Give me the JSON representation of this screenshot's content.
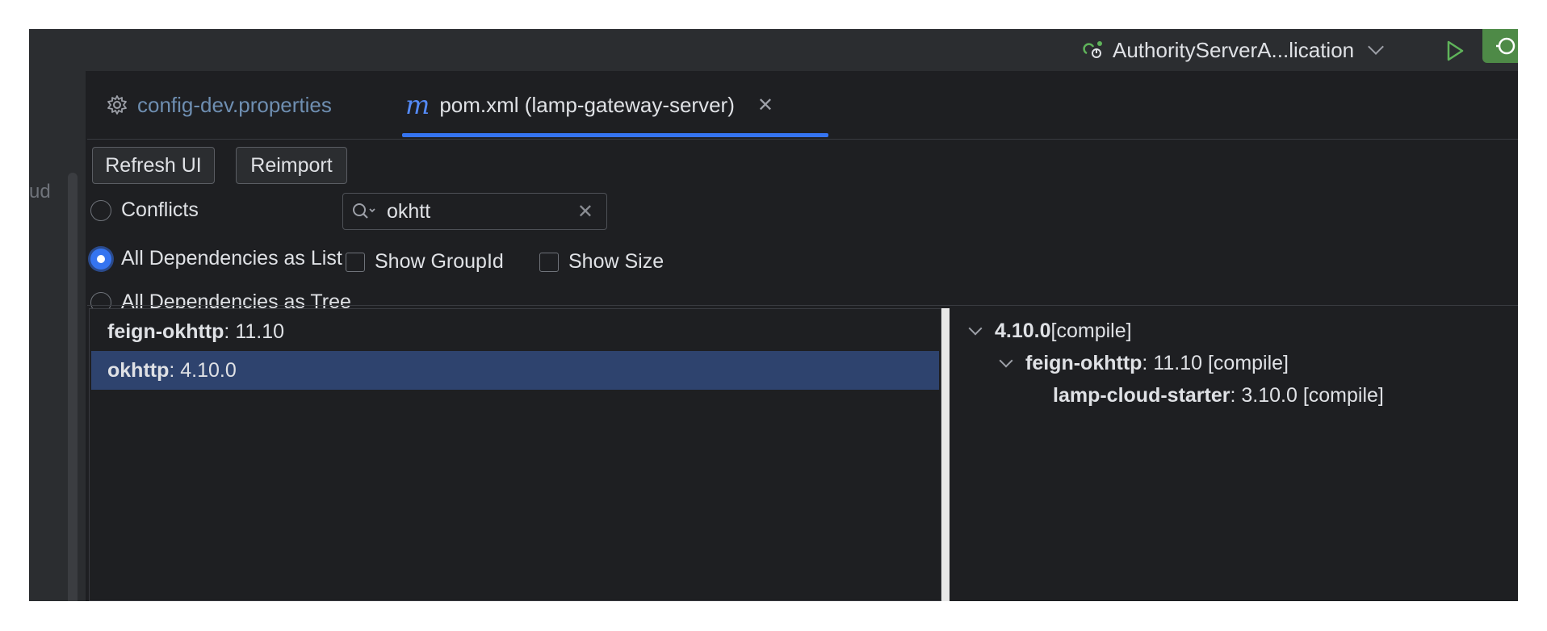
{
  "toolbar": {
    "run_config": "AuthorityServerA...lication"
  },
  "left_strip": {
    "fragment": "ud"
  },
  "tabs": [
    {
      "label": "config-dev.properties"
    },
    {
      "label": "pom.xml (lamp-gateway-server)",
      "icon_text": "m"
    }
  ],
  "actions": {
    "refresh_label": "Refresh UI",
    "reimport_label": "Reimport"
  },
  "view_modes": [
    {
      "label": "Conflicts",
      "selected": false
    },
    {
      "label": "All Dependencies as List",
      "selected": true
    },
    {
      "label": "All Dependencies as Tree",
      "selected": false
    }
  ],
  "search": {
    "value": "okhtt"
  },
  "options": {
    "show_groupid": "Show GroupId",
    "show_size": "Show Size"
  },
  "dependency_list": [
    {
      "name": "feign-okhttp",
      "version": " : 11.10",
      "selected": false
    },
    {
      "name": "okhttp",
      "version": " : 4.10.0",
      "selected": true
    }
  ],
  "dependency_tree": [
    {
      "name": "4.10.0",
      "suffix": " [compile]",
      "level": 0
    },
    {
      "name": "feign-okhttp",
      "suffix": " : 11.10 [compile]",
      "level": 1
    },
    {
      "name": "lamp-cloud-starter",
      "suffix": " : 3.10.0 [compile]",
      "level": 2
    }
  ],
  "colors": {
    "accent": "#3574f0",
    "selection": "#2e436e",
    "run_green": "#4e8a47",
    "background": "#1e1f22"
  }
}
